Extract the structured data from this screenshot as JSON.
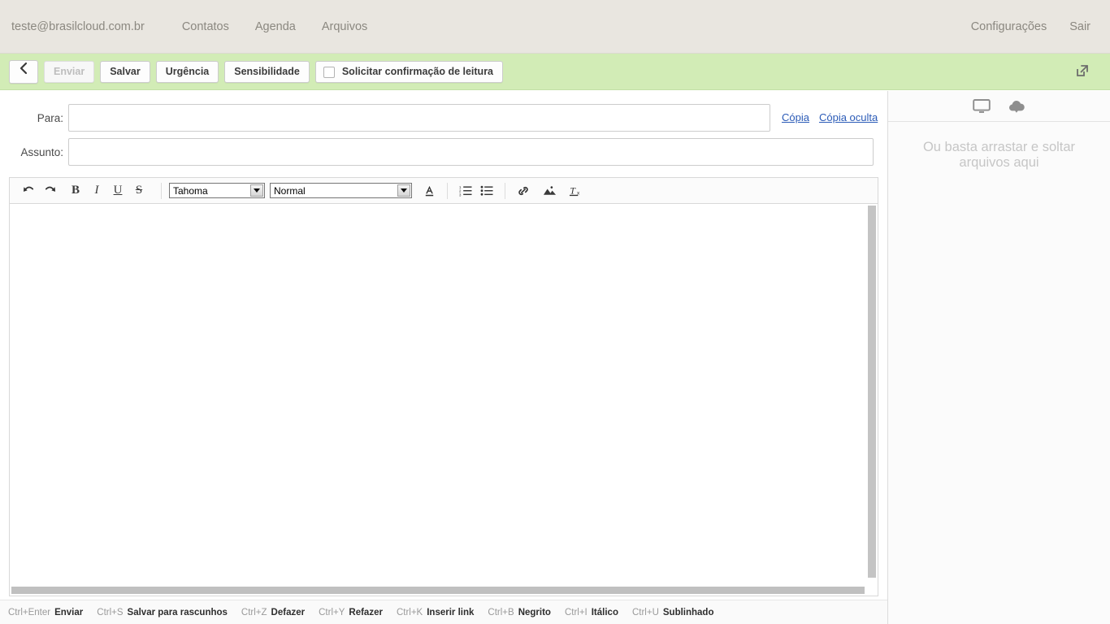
{
  "topbar": {
    "account": "teste@brasilcloud.com.br",
    "nav": [
      {
        "label": "Contatos",
        "name": "nav-contatos"
      },
      {
        "label": "Agenda",
        "name": "nav-agenda"
      },
      {
        "label": "Arquivos",
        "name": "nav-arquivos"
      }
    ],
    "settings": "Configurações",
    "logout": "Sair",
    "bg_color": "#e9e6e0",
    "text_color": "#8b8880"
  },
  "actionbar": {
    "bg_color": "#d2ecb6",
    "back_icon": "chevron-left-icon",
    "send": "Enviar",
    "send_disabled": true,
    "save": "Salvar",
    "urgency": "Urgência",
    "sensitivity": "Sensibilidade",
    "read_receipt": "Solicitar confirmação de leitura",
    "read_receipt_checked": false,
    "expand_icon": "external-link-icon"
  },
  "compose": {
    "to_label": "Para:",
    "to_value": "",
    "to_placeholder": "",
    "subject_label": "Assunto:",
    "subject_value": "",
    "subject_placeholder": "",
    "cc_link": "Cópia",
    "bcc_link": "Cópia oculta",
    "link_color": "#2b5bb7"
  },
  "editor": {
    "undo_icon": "undo-arrow-icon",
    "redo_icon": "redo-arrow-icon",
    "bold": "B",
    "italic": "I",
    "underline": "U",
    "strikethrough": "S",
    "font_family_selected": "Tahoma",
    "font_size_selected": "Normal",
    "text_color_icon": "text-color-icon",
    "ordered_list_icon": "ordered-list-icon",
    "unordered_list_icon": "unordered-list-icon",
    "insert_link_icon": "link-icon",
    "insert_image_icon": "image-icon",
    "clear_format_icon": "clear-formatting-icon",
    "body_value": ""
  },
  "shortcuts": [
    {
      "key": "Ctrl+Enter",
      "action": "Enviar"
    },
    {
      "key": "Ctrl+S",
      "action": "Salvar para rascunhos"
    },
    {
      "key": "Ctrl+Z",
      "action": "Defazer"
    },
    {
      "key": "Ctrl+Y",
      "action": "Refazer"
    },
    {
      "key": "Ctrl+K",
      "action": "Inserir link"
    },
    {
      "key": "Ctrl+B",
      "action": "Negrito"
    },
    {
      "key": "Ctrl+I",
      "action": "Itálico"
    },
    {
      "key": "Ctrl+U",
      "action": "Sublinhado"
    }
  ],
  "attachments": {
    "local_icon": "monitor-icon",
    "cloud_icon": "cloud-upload-icon",
    "hint": "Ou basta arrastar e soltar arquivos aqui",
    "hint_color": "#c6c6c6"
  }
}
